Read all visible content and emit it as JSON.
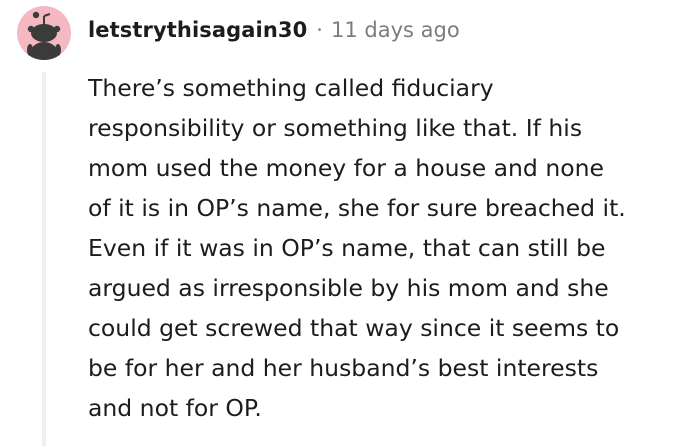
{
  "comment": {
    "author": "letstrythisagain30",
    "separator": "·",
    "timestamp": "11 days ago",
    "body_lines": [
      "There’s something called fiduciary",
      "responsibility or something like that. If his",
      "mom used the money for a house and none",
      "of it is in OP’s name, she for sure breached it.",
      "Even if it was in OP’s name, that can still be",
      "argued as irresponsible by his mom and she",
      "could get screwed that way since it seems to",
      "be for her and her husband’s best interests",
      "and not for OP."
    ]
  },
  "avatar": {
    "icon": "reddit-snoo-avatar-icon",
    "background_color": "#f4b9c0",
    "figure_color": "#3b3b3b"
  },
  "colors": {
    "text": "#1c1c1c",
    "meta": "#7c7c7c",
    "thread_line": "#eef0f2"
  }
}
